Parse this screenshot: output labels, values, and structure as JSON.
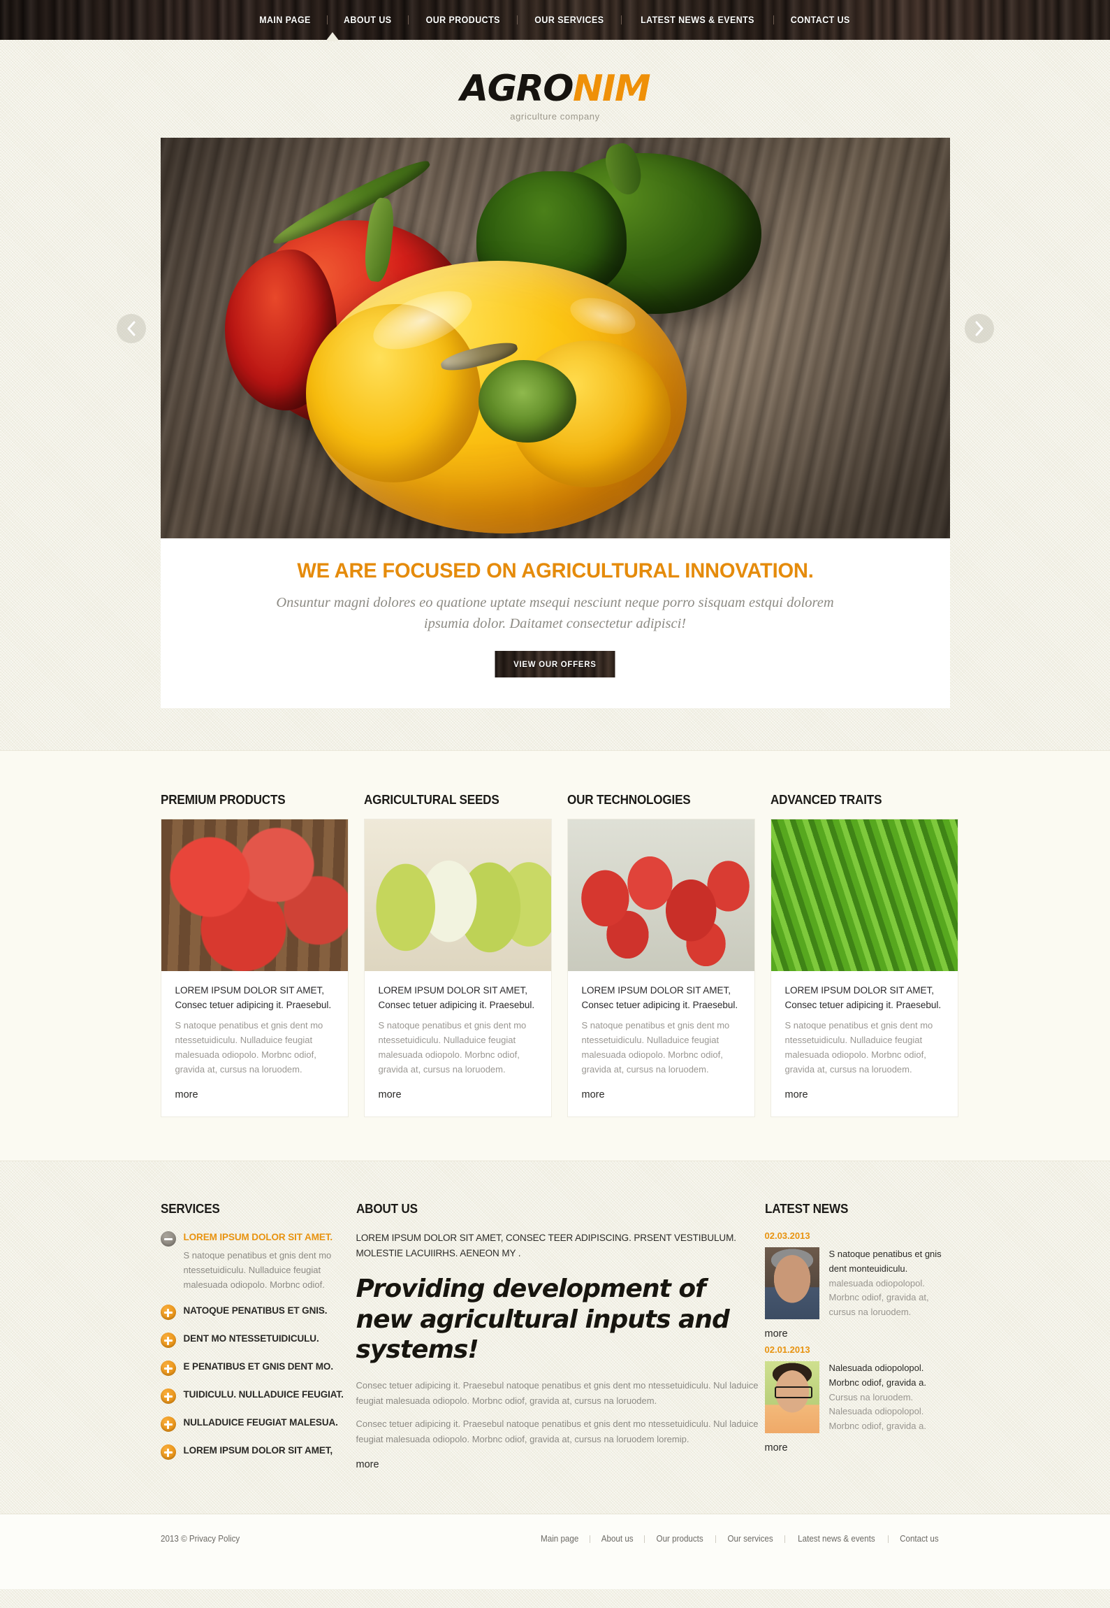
{
  "nav": {
    "items": [
      {
        "label": "MAIN PAGE",
        "active": true
      },
      {
        "label": "ABOUT US",
        "active": false
      },
      {
        "label": "OUR PRODUCTS",
        "active": false
      },
      {
        "label": "OUR SERVICES",
        "active": false
      },
      {
        "label": "LATEST NEWS & EVENTS",
        "active": false
      },
      {
        "label": "CONTACT US",
        "active": false
      }
    ]
  },
  "logo": {
    "part1": "AGRO",
    "part2": "NIM",
    "tagline": "agriculture company",
    "color_dark": "#16130f",
    "color_accent": "#ef9008"
  },
  "slider": {
    "image_alt": "red, yellow and green bell peppers on a wooden board",
    "prev_icon": "chevron-left-icon",
    "next_icon": "chevron-right-icon",
    "title": "WE ARE FOCUSED ON AGRICULTURAL INNOVATION.",
    "description": "Onsuntur magni dolores eo quatione uptate msequi nesciunt neque porro sisquam estqui dolorem ipsumia dolor. Daitamet consectetur adipisci!",
    "button_label": "VIEW OUR OFFERS",
    "title_color": "#e58b0b"
  },
  "products": [
    {
      "title": "PREMIUM PRODUCTS",
      "image_alt": "red apples on a wooden table",
      "head": "LOREM IPSUM DOLOR SIT AMET, Consec tetuer adipicing it. Praesebul.",
      "text": "S natoque penatibus et gnis dent mo ntessetuidiculu. Nulladuice feugiat malesuada odiopolo. Morbnc odiof, gravida at, cursus na loruodem.",
      "more": "more"
    },
    {
      "title": "AGRICULTURAL SEEDS",
      "image_alt": "green pears, one halved",
      "head": "LOREM IPSUM DOLOR SIT AMET, Consec tetuer adipicing it. Praesebul.",
      "text": "S natoque penatibus et gnis dent mo ntessetuidiculu. Nulladuice feugiat malesuada odiopolo. Morbnc odiof, gravida at, cursus na loruodem.",
      "more": "more"
    },
    {
      "title": "OUR TECHNOLOGIES",
      "image_alt": "fresh strawberries",
      "head": "LOREM IPSUM DOLOR SIT AMET, Consec tetuer adipicing it. Praesebul.",
      "text": "S natoque penatibus et gnis dent mo ntessetuidiculu. Nulladuice feugiat malesuada odiopolo. Morbnc odiof, gravida at, cursus na loruodem.",
      "more": "more"
    },
    {
      "title": "ADVANCED TRAITS",
      "image_alt": "bundle of green beans tied with twine",
      "head": "LOREM IPSUM DOLOR SIT AMET, Consec tetuer adipicing it. Praesebul.",
      "text": "S natoque penatibus et gnis dent mo ntessetuidiculu. Nulladuice feugiat malesuada odiopolo. Morbnc odiof, gravida at, cursus na loruodem.",
      "more": "more"
    }
  ],
  "services": {
    "title": "SERVICES",
    "items": [
      {
        "label": "LOREM IPSUM DOLOR SIT AMET.",
        "icon": "minus-circle-icon",
        "expanded": true,
        "desc": "S natoque penatibus et gnis dent mo ntessetuidiculu. Nulladuice feugiat malesuada odiopolo. Morbnc odiof."
      },
      {
        "label": "NATOQUE PENATIBUS ET GNIS.",
        "icon": "plus-circle-icon",
        "expanded": false,
        "desc": ""
      },
      {
        "label": "DENT MO NTESSETUIDICULU.",
        "icon": "plus-circle-icon",
        "expanded": false,
        "desc": ""
      },
      {
        "label": "E PENATIBUS ET GNIS DENT MO.",
        "icon": "plus-circle-icon",
        "expanded": false,
        "desc": ""
      },
      {
        "label": "TUIDICULU. NULLADUICE FEUGIAT.",
        "icon": "plus-circle-icon",
        "expanded": false,
        "desc": ""
      },
      {
        "label": "NULLADUICE FEUGIAT MALESUA.",
        "icon": "plus-circle-icon",
        "expanded": false,
        "desc": ""
      },
      {
        "label": "LOREM IPSUM DOLOR SIT AMET,",
        "icon": "plus-circle-icon",
        "expanded": false,
        "desc": ""
      }
    ]
  },
  "about": {
    "title": "ABOUT US",
    "intro": "LOREM IPSUM DOLOR SIT AMET, CONSEC TEER ADIPISCING. PRSENT VESTIBULUM. MOLESTIE LACUIIRHS. AENEON MY .",
    "headline": "Providing development of new agricultural inputs and systems!",
    "paragraph1": "Consec tetuer adipicing it. Praesebul natoque penatibus et gnis dent mo ntessetuidiculu. Nul laduice feugiat  malesuada odiopolo. Morbnc odiof,  gravida at, cursus na loruodem.",
    "paragraph2": "Consec tetuer adipicing it. Praesebul natoque penatibus et gnis dent mo ntessetuidiculu. Nul laduice feugiat  malesuada odiopolo. Morbnc odiof,  gravida at, cursus na loruodem loremip.",
    "more": "more"
  },
  "news": {
    "title": "LATEST NEWS",
    "items": [
      {
        "date": "02.03.2013",
        "image_alt": "portrait of a man with grey hair and beard",
        "lead": "S natoque penatibus et gnis dent monteuidiculu.",
        "body": "malesuada odiopolopol. Morbnc odiof,  gravida at, cursus na loruodem.",
        "more": "more"
      },
      {
        "date": "02.01.2013",
        "image_alt": "portrait of a smiling young man wearing glasses",
        "lead": "Nalesuada odiopolopol. Morbnc odiof,  gravida a.",
        "body": "Cursus na loruodem. Nalesuada odiopolopol. Morbnc odiof,  gravida a.",
        "more": "more"
      }
    ],
    "date_color": "#e89310"
  },
  "footer": {
    "copyright": "2013 © Privacy Policy",
    "links": [
      "Main page",
      "About us",
      "Our products",
      "Our services",
      "Latest news & events",
      "Contact us"
    ]
  }
}
